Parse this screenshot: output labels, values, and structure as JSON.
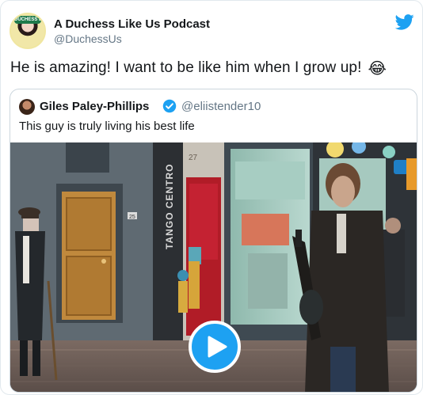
{
  "tweet": {
    "author": {
      "display_name": "A Duchess Like Us Podcast",
      "handle": "@DuchessUs",
      "avatar_badge": "DUCHESS LIKE US"
    },
    "text": "He is amazing! I want to be like him when I grow up!",
    "emoji": "😂",
    "brand_color": "#1da1f2"
  },
  "quoted_tweet": {
    "author": {
      "display_name": "Giles Paley-Phillips",
      "handle": "@eliistender10",
      "verified": true
    },
    "text": "This guy is truly living his best life",
    "media": {
      "type": "video",
      "play_icon": "play-icon",
      "sign_text": "TANGO CENTRO",
      "door_number": "27",
      "plaque_number": "25"
    }
  }
}
